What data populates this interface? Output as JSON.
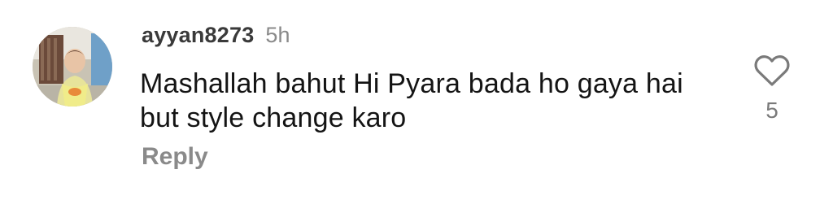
{
  "comment": {
    "username": "ayyan8273",
    "time_ago": "5h",
    "text": "Mashallah bahut Hi Pyara bada ho gaya hai but style change karo",
    "reply_label": "Reply",
    "like_count": "5",
    "like_icon": "heart-outline-icon",
    "avatar_description": "profile photo"
  }
}
